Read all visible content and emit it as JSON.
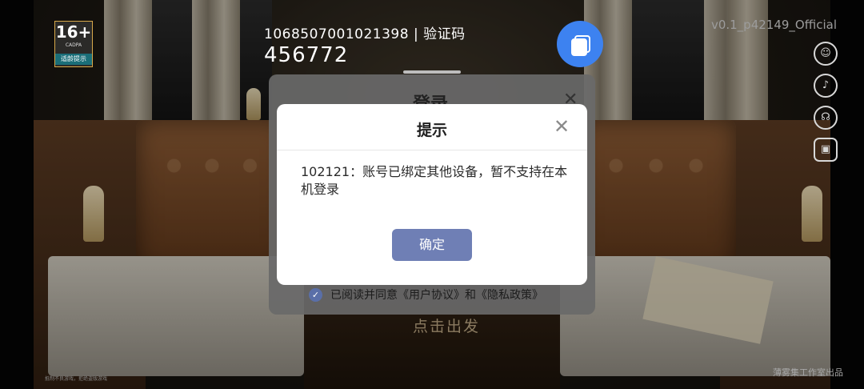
{
  "age_badge": {
    "number": "16+",
    "org": "CADPA",
    "tip": "适龄提示"
  },
  "account": {
    "line": "1068507001021398 | 验证码",
    "code": "456772"
  },
  "version": "v0.1_p42149_Official",
  "side_icons": [
    "user-icon",
    "speaker-icon",
    "headset-icon",
    "save-icon"
  ],
  "login": {
    "title": "登录",
    "agreement": "已阅读并同意《用户协议》和《隐私政策》",
    "depart": "点击出发"
  },
  "modal": {
    "title": "提示",
    "message": "102121：账号已绑定其他设备，暂不支持在本机登录",
    "ok": "确定"
  },
  "footer": {
    "left": "抵制不良游戏，拒绝盗版游戏",
    "right": "薄雾集工作室出品"
  },
  "colors": {
    "modal_button": "#6f7fb5",
    "float_button": "#3d82f0",
    "checkbox": "#5a6fa8"
  }
}
